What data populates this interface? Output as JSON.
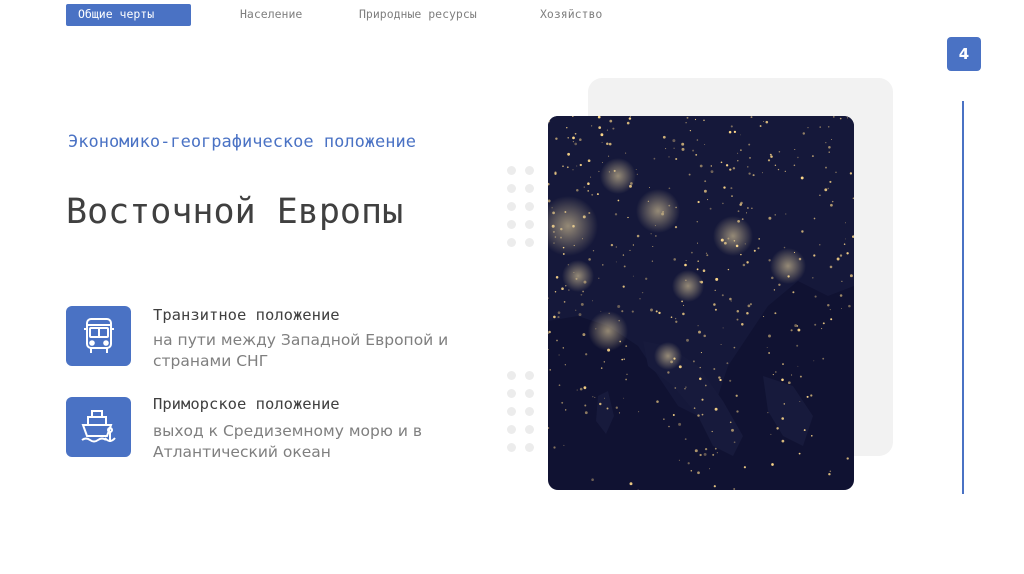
{
  "nav": {
    "tabs": [
      {
        "label": "Общие черты",
        "active": true
      },
      {
        "label": "Население",
        "active": false
      },
      {
        "label": "Природные ресурсы",
        "active": false
      },
      {
        "label": "Хозяйство",
        "active": false
      }
    ]
  },
  "page_number": "4",
  "heading": {
    "subtitle": "Экономико-географическое положение",
    "title": "Восточной Европы"
  },
  "features": [
    {
      "icon": "bus-icon",
      "title": "Транзитное положение",
      "description": "на пути между Западной Европой и странами СНГ"
    },
    {
      "icon": "ship-icon",
      "title": "Приморское положение",
      "description": "выход к Средиземному морю и в Атлантический океан"
    }
  ],
  "colors": {
    "accent": "#4a72c4",
    "title_text": "#404040",
    "muted_text": "#7f7f7f",
    "map_background": "#101232",
    "city_lights": "#ffd98a"
  }
}
